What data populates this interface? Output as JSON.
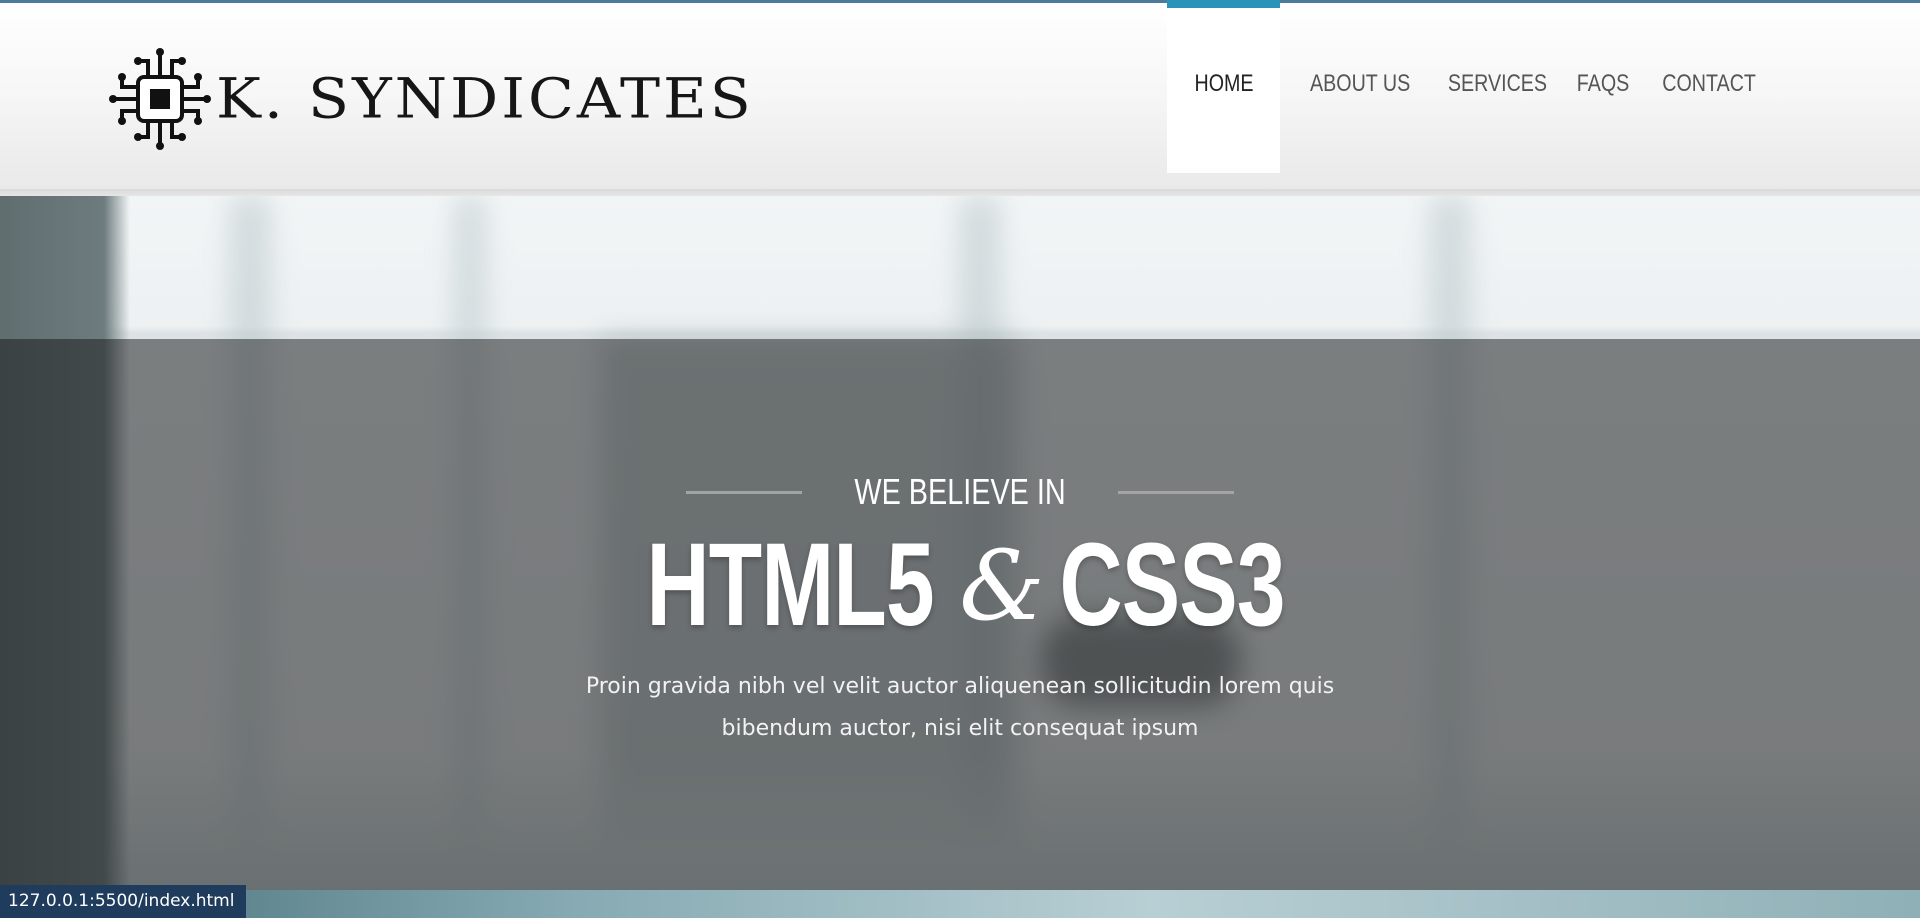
{
  "brand": {
    "name": "K. SYNDICATES",
    "logo_icon": "circuit-chip-icon"
  },
  "nav": {
    "items": [
      {
        "label": "HOME",
        "active": true
      },
      {
        "label": "ABOUT US",
        "active": false
      },
      {
        "label": "SERVICES",
        "active": false
      },
      {
        "label": "FAQS",
        "active": false
      },
      {
        "label": "CONTACT",
        "active": false
      }
    ],
    "accent_color": "#2a93b8"
  },
  "hero": {
    "eyebrow": "WE BELIEVE IN",
    "headline_left": "HTML5",
    "headline_amp": "&",
    "headline_right": "CSS3",
    "subtext_line1": "Proin gravida nibh vel velit auctor aliquenean sollicitudin lorem quis",
    "subtext_line2": "bibendum auctor, nisi elit consequat ipsum"
  },
  "statusbar": {
    "url": "127.0.0.1:5500/index.html"
  }
}
